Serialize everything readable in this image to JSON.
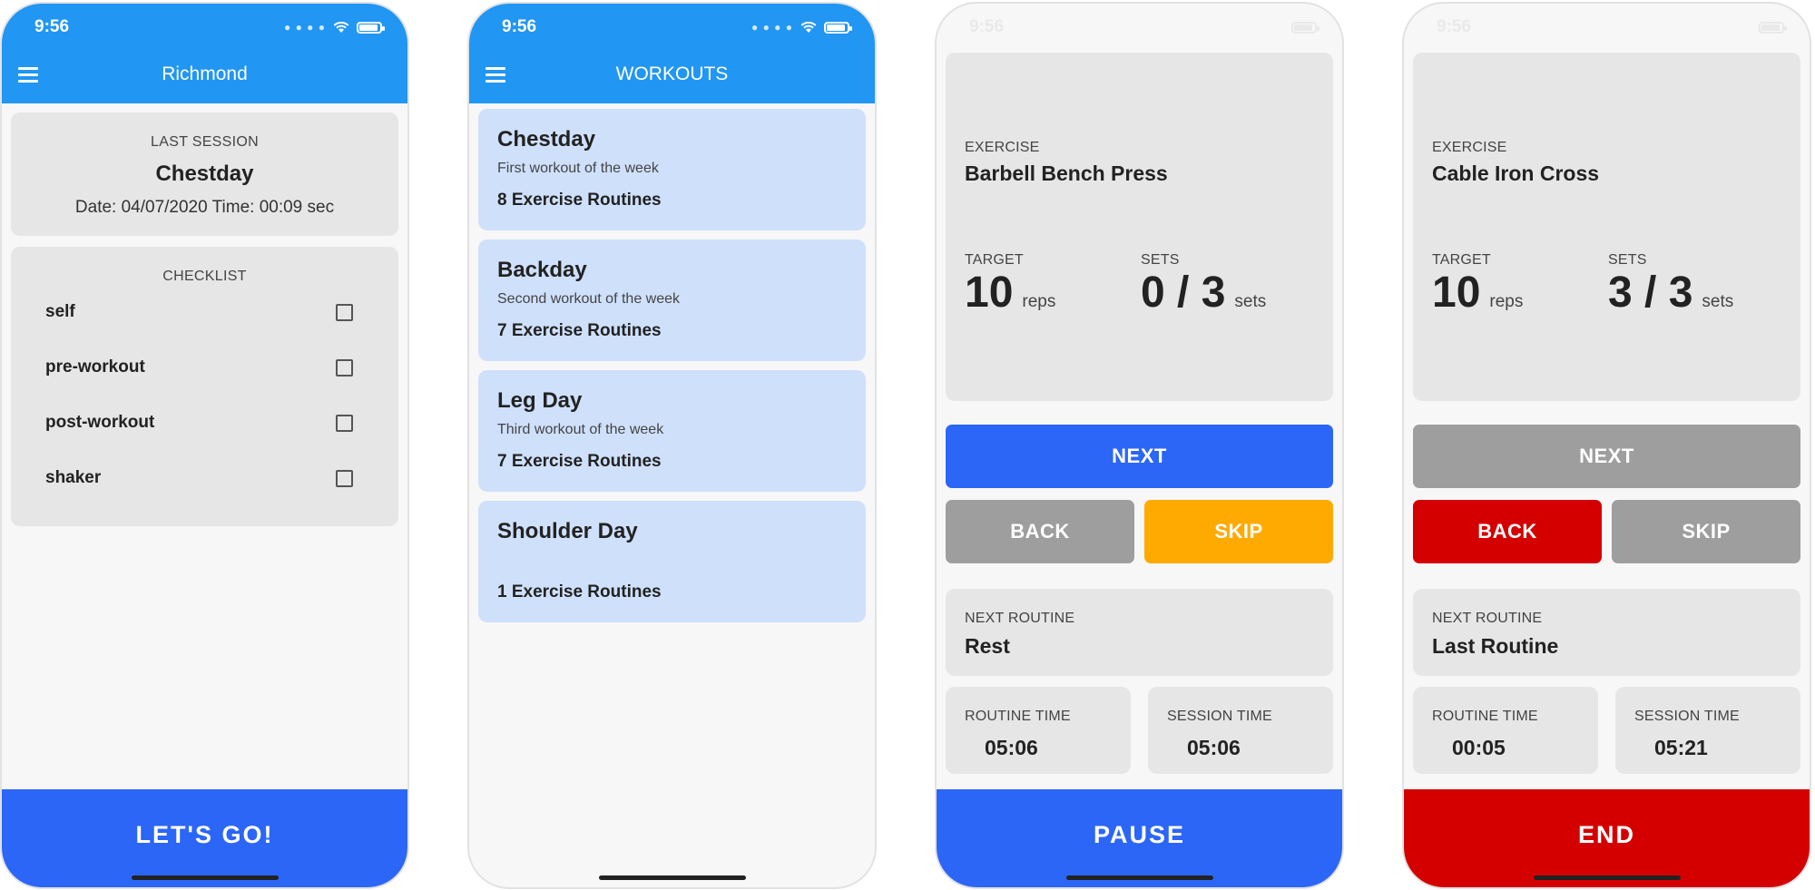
{
  "colors": {
    "app_blue": "#2196f3",
    "action_blue": "#2c66f7",
    "danger_red": "#d40000",
    "warn_amber": "#ffaa00",
    "disabled_gray": "#9e9e9e",
    "card_gray": "#e6e6e6",
    "workout_card_blue": "#cfe0fb"
  },
  "screens": [
    {
      "status_time": "9:56",
      "appbar_title": "Richmond",
      "menu_icon": "hamburger-menu-icon",
      "last_session": {
        "caption": "LAST SESSION",
        "name": "Chestday",
        "meta": "Date: 04/07/2020 Time: 00:09 sec"
      },
      "checklist": {
        "caption": "CHECKLIST",
        "items": [
          {
            "label": "self",
            "checked": false
          },
          {
            "label": "pre-workout",
            "checked": false
          },
          {
            "label": "post-workout",
            "checked": false
          },
          {
            "label": "shaker",
            "checked": false
          }
        ]
      },
      "bottom_button": "LET'S GO!"
    },
    {
      "status_time": "9:56",
      "appbar_title": "WORKOUTS",
      "menu_icon": "hamburger-menu-icon",
      "workouts": [
        {
          "name": "Chestday",
          "description": "First workout of the week",
          "count": "8 Exercise Routines"
        },
        {
          "name": "Backday",
          "description": "Second workout of the week",
          "count": "7 Exercise Routines"
        },
        {
          "name": "Leg Day",
          "description": "Third workout of the week",
          "count": "7 Exercise Routines"
        },
        {
          "name": "Shoulder Day",
          "description": "",
          "count": "1 Exercise Routines"
        }
      ]
    },
    {
      "status_time": "9:56",
      "exercise_caption": "EXERCISE",
      "exercise_name": "Barbell Bench Press",
      "target_caption": "TARGET",
      "target_value": "10",
      "target_unit": "reps",
      "sets_caption": "SETS",
      "sets_value": "0 / 3",
      "sets_unit": "sets",
      "next_label": "NEXT",
      "back_label": "BACK",
      "skip_label": "SKIP",
      "next_routine_caption": "NEXT ROUTINE",
      "next_routine_name": "Rest",
      "routine_time_caption": "ROUTINE TIME",
      "routine_time": "05:06",
      "session_time_caption": "SESSION TIME",
      "session_time": "05:06",
      "bottom_button": "PAUSE"
    },
    {
      "status_time": "9:56",
      "exercise_caption": "EXERCISE",
      "exercise_name": "Cable Iron Cross",
      "target_caption": "TARGET",
      "target_value": "10",
      "target_unit": "reps",
      "sets_caption": "SETS",
      "sets_value": "3 / 3",
      "sets_unit": "sets",
      "next_label": "NEXT",
      "back_label": "BACK",
      "skip_label": "SKIP",
      "next_routine_caption": "NEXT ROUTINE",
      "next_routine_name": "Last Routine",
      "routine_time_caption": "ROUTINE TIME",
      "routine_time": "00:05",
      "session_time_caption": "SESSION TIME",
      "session_time": "05:21",
      "bottom_button": "END"
    }
  ]
}
